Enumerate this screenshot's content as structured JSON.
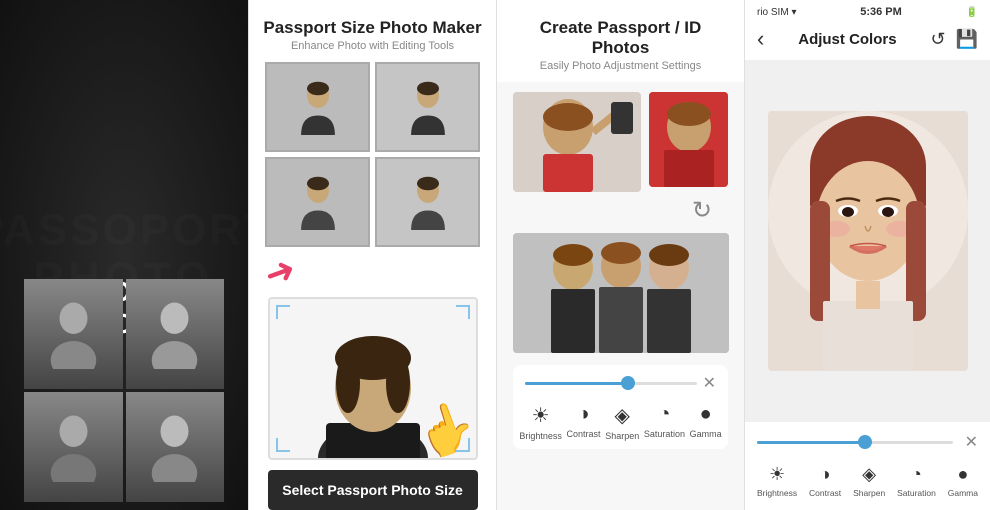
{
  "panels": [
    {
      "id": "panel1",
      "bg_text": [
        "PASSOPORT",
        "PHOTO"
      ],
      "title_line1": "PASSOPORT",
      "title_line2": "PHOTO"
    },
    {
      "id": "panel2",
      "title": "Passport Size Photo Maker",
      "subtitle": "Enhance Photo with Editing Tools",
      "button_label": "Select Passport Photo Size"
    },
    {
      "id": "panel3",
      "title": "Create Passport / ID Photos",
      "subtitle": "Easily Photo Adjustment Settings",
      "toolbar": {
        "items": [
          {
            "label": "Brightness",
            "icon": "☀"
          },
          {
            "label": "Contrast",
            "icon": "◑"
          },
          {
            "label": "Sharpen",
            "icon": "◈"
          },
          {
            "label": "Saturation",
            "icon": "◔"
          },
          {
            "label": "Gamma",
            "icon": "●"
          }
        ]
      }
    },
    {
      "id": "panel4",
      "statusbar": {
        "carrier": "rio SIM ▾",
        "time": "5:36 PM",
        "battery": "■■"
      },
      "header": {
        "back_label": "‹",
        "title": "Adjust Colors",
        "undo_icon": "↺",
        "save_icon": "⬛"
      },
      "toolbar": {
        "close_label": "✕",
        "items": [
          {
            "label": "Brightness",
            "icon": "☀"
          },
          {
            "label": "Contrast",
            "icon": "◑"
          },
          {
            "label": "Sharpen",
            "icon": "◈"
          },
          {
            "label": "Saturation",
            "icon": "◔"
          },
          {
            "label": "Gamma",
            "icon": "●"
          }
        ]
      }
    }
  ]
}
